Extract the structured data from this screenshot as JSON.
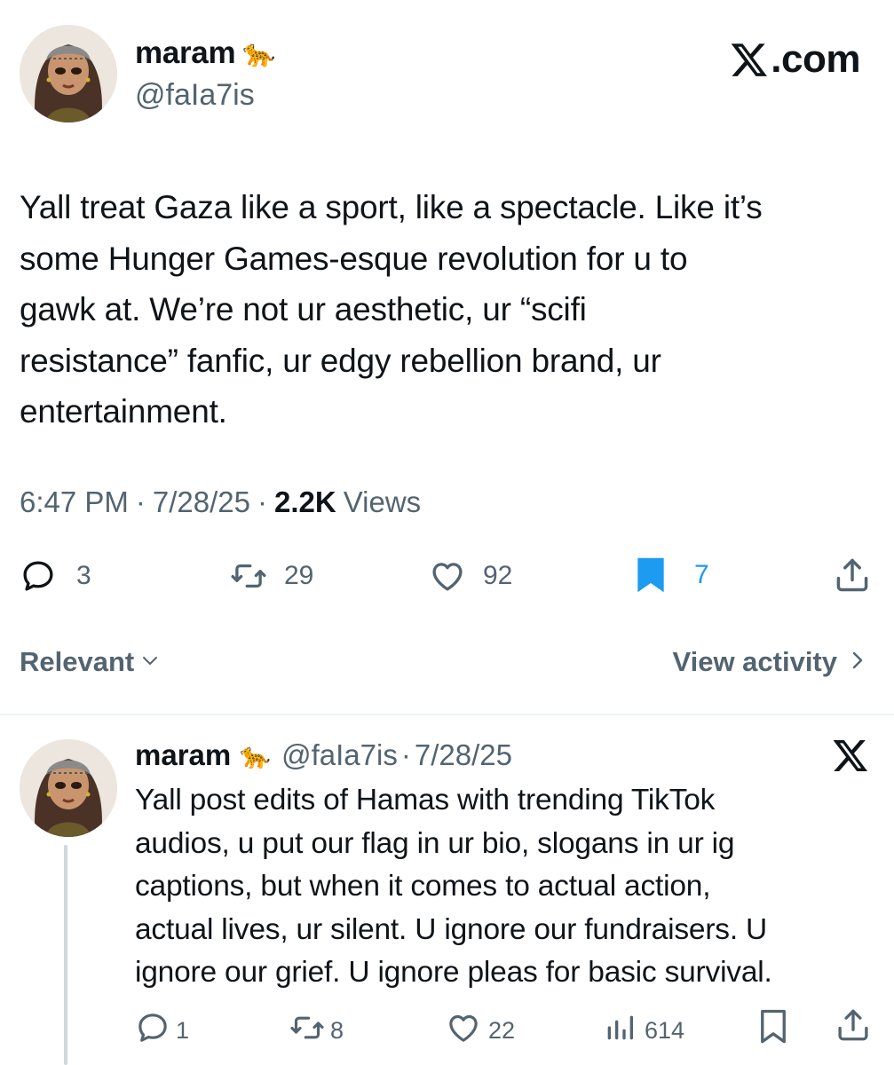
{
  "main_tweet": {
    "author_name": "maram",
    "author_emoji": "🐆",
    "handle": "@faIa7is",
    "text_lines": [
      "Yall treat Gaza like a sport, like a spectacle. Like it’s",
      "some Hunger Games-esque revolution for u to",
      "gawk at. We’re not ur aesthetic, ur “scifi",
      "resistance” fanfic, ur edgy rebellion brand, ur",
      "entertainment."
    ],
    "time": "6:47 PM",
    "date": "7/28/25",
    "views_count": "2.2K",
    "views_label": "Views",
    "replies": "3",
    "reposts": "29",
    "likes": "92",
    "bookmarks": "7"
  },
  "brand": {
    "text": ".com"
  },
  "sort": {
    "label": "Relevant"
  },
  "activity": {
    "label": "View activity"
  },
  "reply_tweet": {
    "author_name": "maram",
    "author_emoji": "🐆",
    "handle": "@faIa7is",
    "date": "7/28/25",
    "text_lines": [
      "Yall post edits of Hamas with trending TikTok",
      "audios, u put our flag in ur bio, slogans in ur ig",
      "captions, but when it comes to actual action,",
      "actual lives, ur silent. U ignore our fundraisers. U",
      "ignore our grief. U ignore pleas for basic survival."
    ],
    "replies": "1",
    "reposts": "8",
    "likes": "22",
    "views": "614"
  },
  "colors": {
    "text": "#0f1419",
    "secondary": "#536471",
    "bookmark_active": "#1d9bf0",
    "divider": "#eff3f4",
    "thread_line": "#cfd9de"
  },
  "icons": [
    "reply-icon",
    "repost-icon",
    "like-icon",
    "bookmark-icon",
    "share-icon",
    "views-icon",
    "x-logo-icon",
    "chevron-down-icon",
    "chevron-right-icon",
    "leopard-emoji"
  ]
}
